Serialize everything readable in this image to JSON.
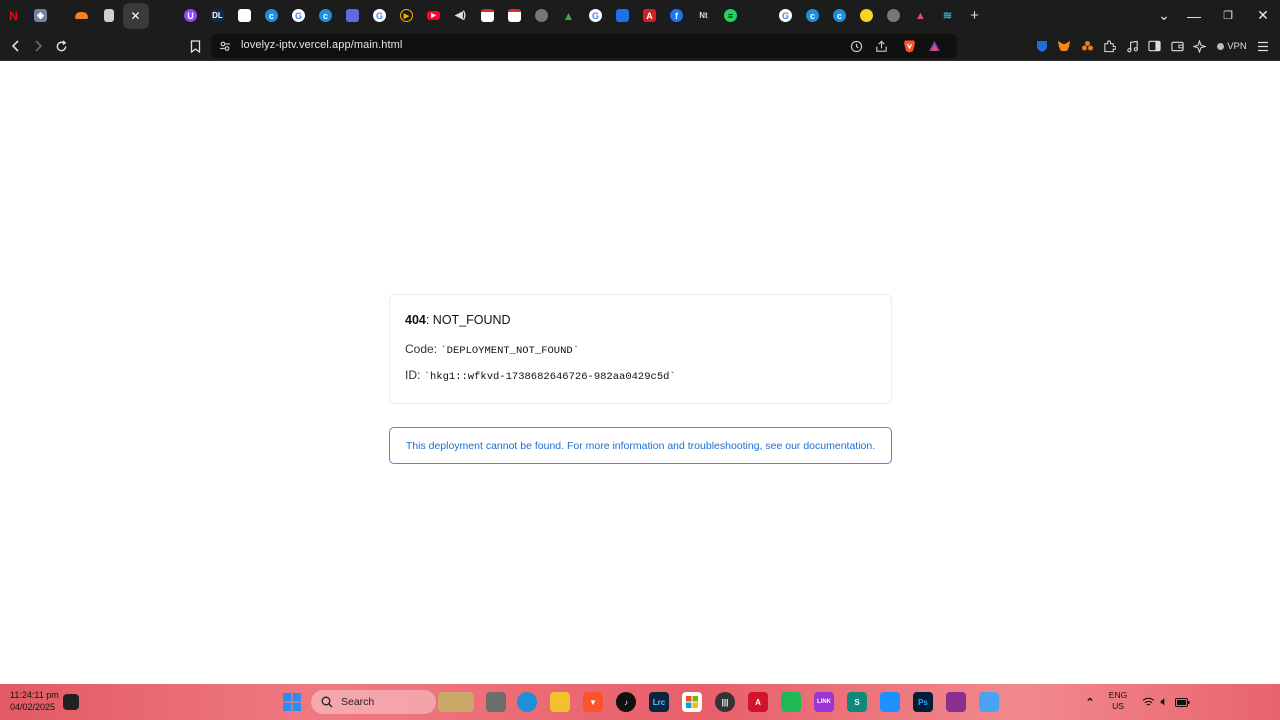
{
  "browser": {
    "url": "lovelyz-iptv.vercel.app/main.html",
    "vpn_label": "VPN",
    "tab_icons": [
      "netflix-icon",
      "shield-tab-icon",
      "cloudflare-icon",
      "document-tab-icon",
      "close-icon",
      "twitch-icon",
      "dl-icon",
      "blank-page-icon",
      "copilot-icon",
      "google-icon",
      "copilot-icon",
      "note-icon",
      "google-icon",
      "play-icon",
      "youtube-icon",
      "audio-icon",
      "gmail-icon",
      "gmail-icon",
      "globe-icon",
      "drive-icon",
      "google-icon",
      "photos-icon",
      "pdf-icon",
      "facebook-icon",
      "notion-icon",
      "spotify-icon",
      "google-icon",
      "copilot-icon",
      "copilot-icon",
      "yellow-circle-icon",
      "globe-icon",
      "arc-icon",
      "wave-icon"
    ]
  },
  "error": {
    "code_number": "404",
    "code_text": ": NOT_FOUND",
    "code_label": "Code:",
    "code_value": "`DEPLOYMENT_NOT_FOUND`",
    "id_label": "ID:",
    "id_value": "`hkg1::wfkvd-1738682646726-982aa0429c5d`"
  },
  "notice": {
    "text": "This deployment cannot be found. For more information and troubleshooting, see our documentation."
  },
  "taskbar": {
    "time": "11:24:11 pm",
    "date": "04/02/2025",
    "search_label": "Search",
    "lang_top": "ENG",
    "lang_bottom": "US"
  },
  "colors": {
    "accent": "#3a8ee6",
    "notice_text": "#1a6fd4",
    "chrome_bg": "#1c1c1c"
  }
}
